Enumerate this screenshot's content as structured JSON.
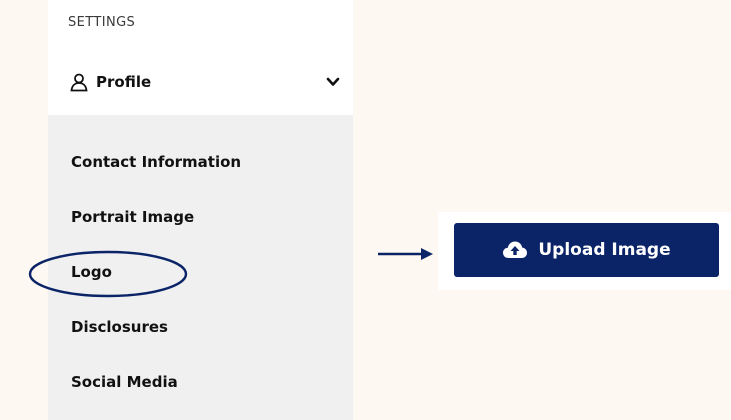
{
  "sidebar": {
    "heading": "SETTINGS",
    "profile": {
      "label": "Profile",
      "icon": "person-icon",
      "chevron": "chevron-down-icon"
    },
    "items": [
      {
        "label": "Contact Information"
      },
      {
        "label": "Portrait Image"
      },
      {
        "label": "Logo",
        "highlighted": true
      },
      {
        "label": "Disclosures"
      },
      {
        "label": "Social Media"
      }
    ]
  },
  "upload": {
    "button_label": "Upload Image",
    "icon": "cloud-upload-icon"
  },
  "colors": {
    "background": "#fdf8f1",
    "submenu_bg": "#f0f0f0",
    "button_bg": "#0b2468",
    "annotation": "#0b2468"
  }
}
